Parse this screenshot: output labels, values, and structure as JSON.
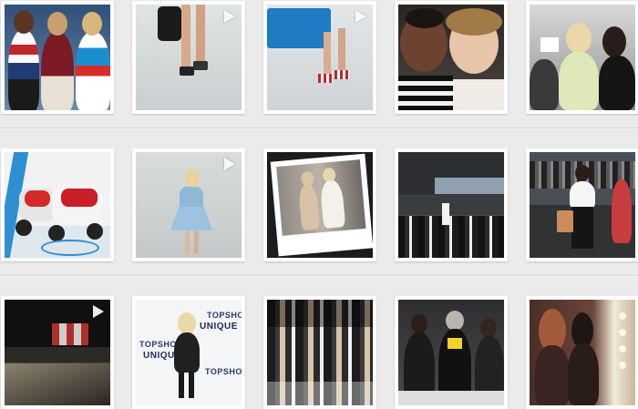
{
  "gallery": {
    "tiles": [
      {
        "row": 0,
        "col": 0,
        "subject": "three-models-striped-sweaters",
        "is_video": false
      },
      {
        "row": 0,
        "col": 1,
        "subject": "legs-with-handbag-and-heels",
        "is_video": true
      },
      {
        "row": 0,
        "col": 2,
        "subject": "blue-clutch-and-striped-heels",
        "is_video": true
      },
      {
        "row": 0,
        "col": 3,
        "subject": "two-women-selfie",
        "is_video": false
      },
      {
        "row": 0,
        "col": 4,
        "subject": "two-women-backstage",
        "is_video": false
      },
      {
        "row": 1,
        "col": 0,
        "subject": "red-and-white-scooters",
        "is_video": false
      },
      {
        "row": 1,
        "col": 1,
        "subject": "model-in-light-blue-dress",
        "is_video": true
      },
      {
        "row": 1,
        "col": 2,
        "subject": "polaroid-two-models",
        "is_video": false
      },
      {
        "row": 1,
        "col": 3,
        "subject": "runway-show-crowd",
        "is_video": false
      },
      {
        "row": 1,
        "col": 4,
        "subject": "woman-with-tan-bag",
        "is_video": false
      },
      {
        "row": 2,
        "col": 0,
        "subject": "dark-runway-finale",
        "is_video": true
      },
      {
        "row": 2,
        "col": 1,
        "subject": "blonde-at-topshop-unique-wall",
        "is_video": false,
        "wall_text": [
          "TOPSHOP",
          "UNIQUE",
          "TOPSHOP",
          "UNIQUE",
          "TOPSHOP"
        ]
      },
      {
        "row": 2,
        "col": 2,
        "subject": "front-row-audience",
        "is_video": false
      },
      {
        "row": 2,
        "col": 3,
        "subject": "front-row-guests-seated",
        "is_video": false
      },
      {
        "row": 2,
        "col": 4,
        "subject": "women-with-mirror-lights",
        "is_video": false
      }
    ]
  }
}
